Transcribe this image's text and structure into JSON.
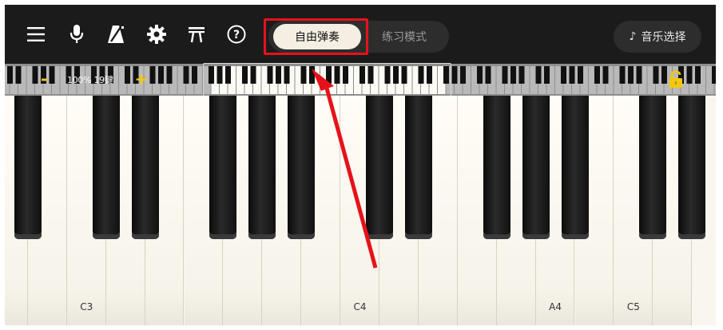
{
  "toolbar": {
    "icons": [
      "menu-icon",
      "microphone-icon",
      "metronome-icon",
      "settings-gear-icon",
      "pi-icon",
      "help-icon"
    ],
    "mode_tabs": [
      {
        "label": "自由弹奏",
        "selected": true
      },
      {
        "label": "练习模式",
        "selected": false
      }
    ],
    "music_select_label": "音乐选择"
  },
  "keyboard_nav": {
    "zoom_label": "100% 19键",
    "minus_label": "-",
    "plus_label": "+",
    "lock_state": "unlocked"
  },
  "piano": {
    "key_labels": {
      "C3": "C3",
      "C4": "C4",
      "A4": "A4",
      "C5": "C5"
    },
    "white_key_count": 18
  },
  "annotation": {
    "highlight_color": "#e6121a",
    "arrow_color": "#e6121a"
  },
  "colors": {
    "accent": "#f6c800",
    "toolbar_bg": "#1b1b1b",
    "selected_tab_bg": "#f4efe2"
  }
}
